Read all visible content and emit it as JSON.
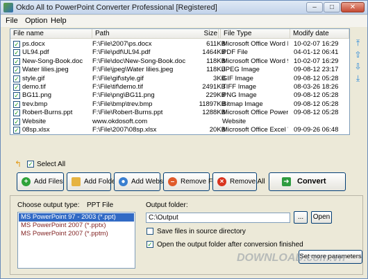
{
  "window": {
    "title": "Okdo All to PowerPoint Converter Professional [Registered]"
  },
  "menu": [
    "File",
    "Option",
    "Help"
  ],
  "table": {
    "headers": [
      "File name",
      "Path",
      "Size",
      "File Type",
      "Modify date"
    ],
    "rows": [
      {
        "name": "ps.docx",
        "path": "F:\\File\\2007\\ps.docx",
        "size": "611KB",
        "type": "Microsoft Office Word D...",
        "date": "10-02-07 16:29"
      },
      {
        "name": "UL94.pdf",
        "path": "F:\\File\\pdf\\UL94.pdf",
        "size": "1464KB",
        "type": "PDF File",
        "date": "04-01-12 06:41"
      },
      {
        "name": "New-Song-Book.doc",
        "path": "F:\\File\\doc\\New-Song-Book.doc",
        "size": "118KB",
        "type": "Microsoft Office Word 97...",
        "date": "10-02-07 16:29"
      },
      {
        "name": "Water lilies.jpeg",
        "path": "F:\\File\\jpeg\\Water lilies.jpeg",
        "size": "118KB",
        "type": "JPEG Image",
        "date": "09-08-12 23:17"
      },
      {
        "name": "style.gif",
        "path": "F:\\File\\gif\\style.gif",
        "size": "3KB",
        "type": "GIF Image",
        "date": "09-08-12 05:28"
      },
      {
        "name": "demo.tif",
        "path": "F:\\File\\tif\\demo.tif",
        "size": "2491KB",
        "type": "TIFF Image",
        "date": "08-03-26 18:26"
      },
      {
        "name": "BG11.png",
        "path": "F:\\File\\png\\BG11.png",
        "size": "229KB",
        "type": "PNG Image",
        "date": "09-08-12 05:28"
      },
      {
        "name": "trev.bmp",
        "path": "F:\\File\\bmp\\trev.bmp",
        "size": "11897KB",
        "type": "Bitmap Image",
        "date": "09-08-12 05:28"
      },
      {
        "name": "Robert-Burns.ppt",
        "path": "F:\\File\\Robert-Burns.ppt",
        "size": "1288KB",
        "type": "Microsoft Office PowerP...",
        "date": "09-08-12 05:28"
      },
      {
        "name": "Website",
        "path": "www.okdosoft.com",
        "size": "",
        "type": "Website",
        "date": ""
      },
      {
        "name": "08sp.xlsx",
        "path": "F:\\File\\2007\\08sp.xlsx",
        "size": "20KB",
        "type": "Microsoft Office Excel W...",
        "date": "09-09-26 06:48"
      }
    ]
  },
  "select_all": {
    "label": "Select All",
    "checked": true
  },
  "buttons": {
    "add_files": "Add Files",
    "add_folder": "Add Folder",
    "add_website": "Add Website",
    "remove_file": "Remove File",
    "remove_all": "Remove All",
    "convert": "Convert"
  },
  "output": {
    "type_label": "Choose output type:",
    "type_value": "PPT File",
    "formats": [
      "MS PowerPoint 97 - 2003 (*.ppt)",
      "MS PowerPoint 2007 (*.pptx)",
      "MS PowerPoint 2007 (*.pptm)"
    ],
    "folder_label": "Output folder:",
    "folder_value": "C:\\Output",
    "browse_label": "...",
    "open_label": "Open",
    "save_in_source": "Save files in source directory",
    "open_after": "Open the output folder after conversion finished",
    "more_label": "Set more parameters"
  },
  "watermark": "DOWNLOAD.com.vn"
}
